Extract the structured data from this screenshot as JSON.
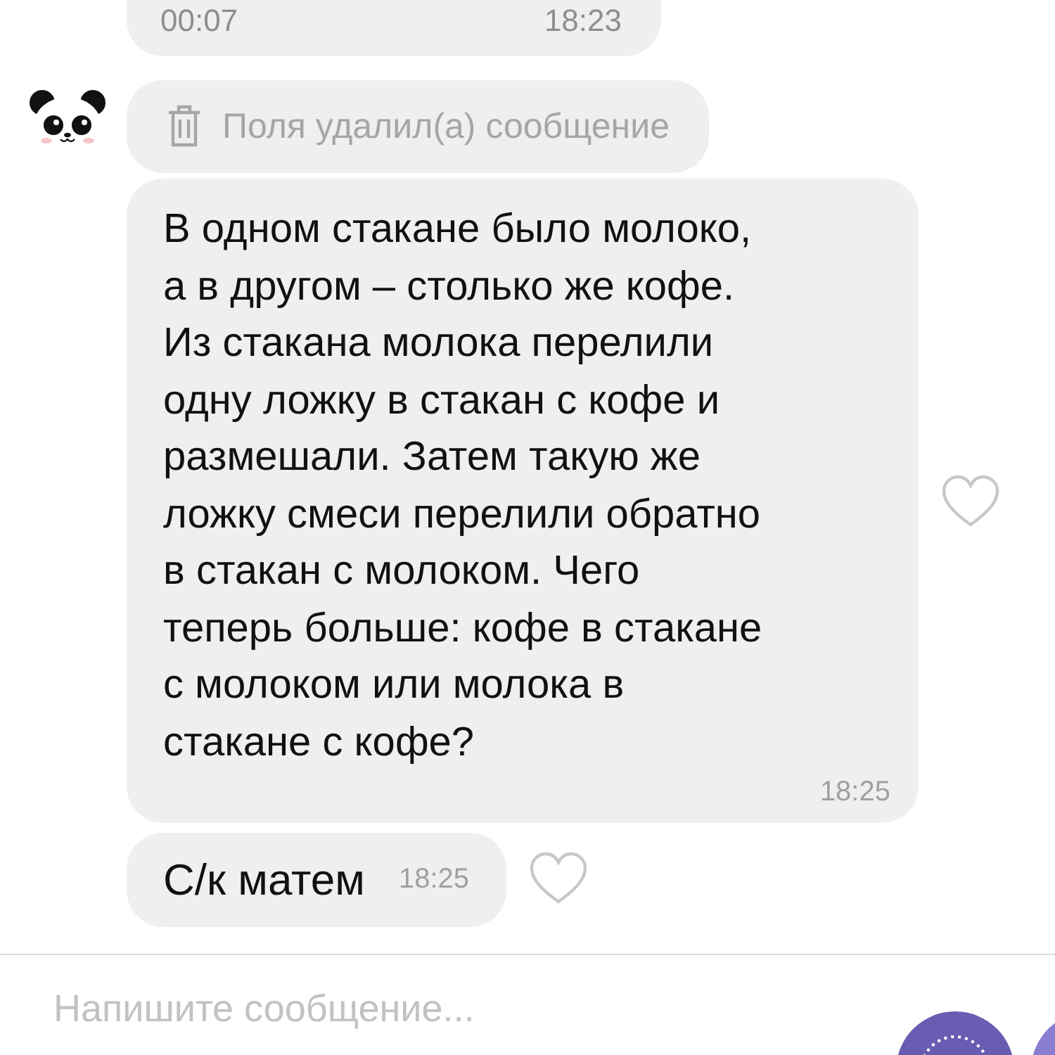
{
  "messages": [
    {
      "kind": "voice",
      "duration": "00:07",
      "time": "18:23"
    },
    {
      "kind": "deleted",
      "text": "Поля удалил(а) сообщение"
    },
    {
      "kind": "text",
      "text": "В одном стакане было молоко,\nа в другом – столько же кофе.\nИз стакана молока перелили\nодну ложку в стакан с кофе и\nразмешали. Затем такую же\nложку смеси перелили обратно\nв стакан с молоком. Чего\nтеперь больше: кофе в стакане\nс молоком или молока в\nстакане с кофе?",
      "time": "18:25"
    },
    {
      "kind": "short",
      "text": "С/к матем",
      "time": "18:25"
    }
  ],
  "composer": {
    "placeholder": "Напишите сообщение..."
  }
}
